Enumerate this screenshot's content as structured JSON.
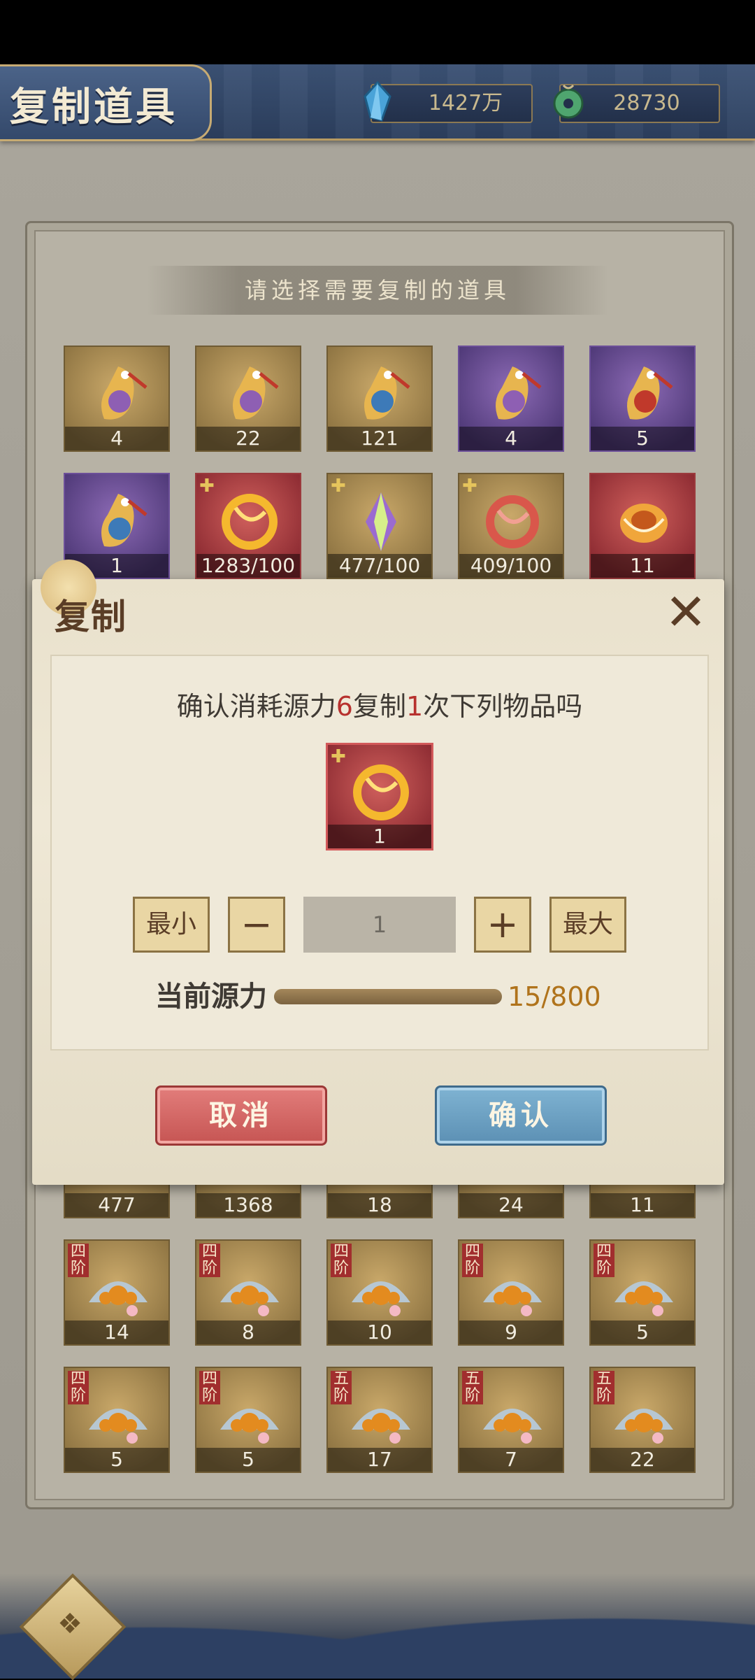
{
  "header": {
    "title": "复制道具",
    "currencies": [
      {
        "icon": "crystal-icon",
        "value": "1427万"
      },
      {
        "icon": "jade-coin-icon",
        "value": "28730"
      }
    ]
  },
  "select_prompt": "请选择需要复制的道具",
  "items_row1": [
    {
      "count": "4",
      "rarity": "gold",
      "icon": "fish-charm-icon"
    },
    {
      "count": "22",
      "rarity": "gold",
      "icon": "fish-charm-icon"
    },
    {
      "count": "121",
      "rarity": "gold",
      "icon": "fish-charm-icon"
    },
    {
      "count": "4",
      "rarity": "purple",
      "icon": "fish-charm-icon"
    },
    {
      "count": "5",
      "rarity": "purple",
      "icon": "fish-charm-icon"
    }
  ],
  "items_row2": [
    {
      "count": "1",
      "rarity": "purple",
      "icon": "fish-charm-icon"
    },
    {
      "count": "1283/100",
      "rarity": "red",
      "icon": "golden-dragon-fragment-icon"
    },
    {
      "count": "477/100",
      "rarity": "gold",
      "icon": "crystal-fragment-icon"
    },
    {
      "count": "409/100",
      "rarity": "gold",
      "icon": "red-dragon-fragment-icon"
    },
    {
      "count": "11",
      "rarity": "red",
      "icon": "amber-orb-icon"
    }
  ],
  "items_row3": [
    {
      "count": "477"
    },
    {
      "count": "1368"
    },
    {
      "count": "18"
    },
    {
      "count": "24"
    },
    {
      "count": "11"
    }
  ],
  "items_row4": [
    {
      "count": "14",
      "tier": "四阶"
    },
    {
      "count": "8",
      "tier": "四阶"
    },
    {
      "count": "10",
      "tier": "四阶"
    },
    {
      "count": "9",
      "tier": "四阶"
    },
    {
      "count": "5",
      "tier": "四阶"
    }
  ],
  "items_row5": [
    {
      "count": "5",
      "tier": "四阶"
    },
    {
      "count": "5",
      "tier": "四阶"
    },
    {
      "count": "17",
      "tier": "五阶"
    },
    {
      "count": "7",
      "tier": "五阶"
    },
    {
      "count": "22",
      "tier": "五阶"
    }
  ],
  "dialog": {
    "title": "复制",
    "confirm_prefix": "确认消耗源力",
    "cost": "6",
    "confirm_mid": "复制",
    "times": "1",
    "confirm_suffix": "次下列物品吗",
    "item_count": "1",
    "min_label": "最小",
    "minus_label": "−",
    "quantity": "1",
    "plus_label": "+",
    "max_label": "最大",
    "power_label": "当前源力",
    "power_value": "15/800",
    "power_fraction": 0.019,
    "cancel_label": "取消",
    "ok_label": "确认"
  }
}
